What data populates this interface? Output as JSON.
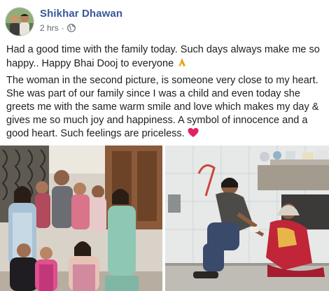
{
  "post": {
    "author": "Shikhar Dhawan",
    "timestamp": "2 hrs",
    "separator": "·",
    "privacy_icon": "globe-icon",
    "paragraph1": "Had a good time with the family today. Such days always make me so happy.. Happy Bhai Dooj to everyone",
    "paragraph1_emoji": "folded-hands-icon",
    "paragraph2": "The woman in the second picture, is someone very close to my heart. She was part of our family since I was a child and even today she greets me with the same warm smile and love which makes my day & gives me so much joy and happiness. A symbol of innocence and a good heart. Such feelings are priceless.",
    "paragraph2_emoji": "red-heart-icon"
  },
  "colors": {
    "author_link": "#385898",
    "meta_text": "#616770",
    "body_text": "#1c1e21",
    "heart": "#e0245e",
    "hands": "#f5b631"
  },
  "photos": [
    {
      "name": "family-group-photo"
    },
    {
      "name": "elder-woman-greeting-photo"
    }
  ]
}
